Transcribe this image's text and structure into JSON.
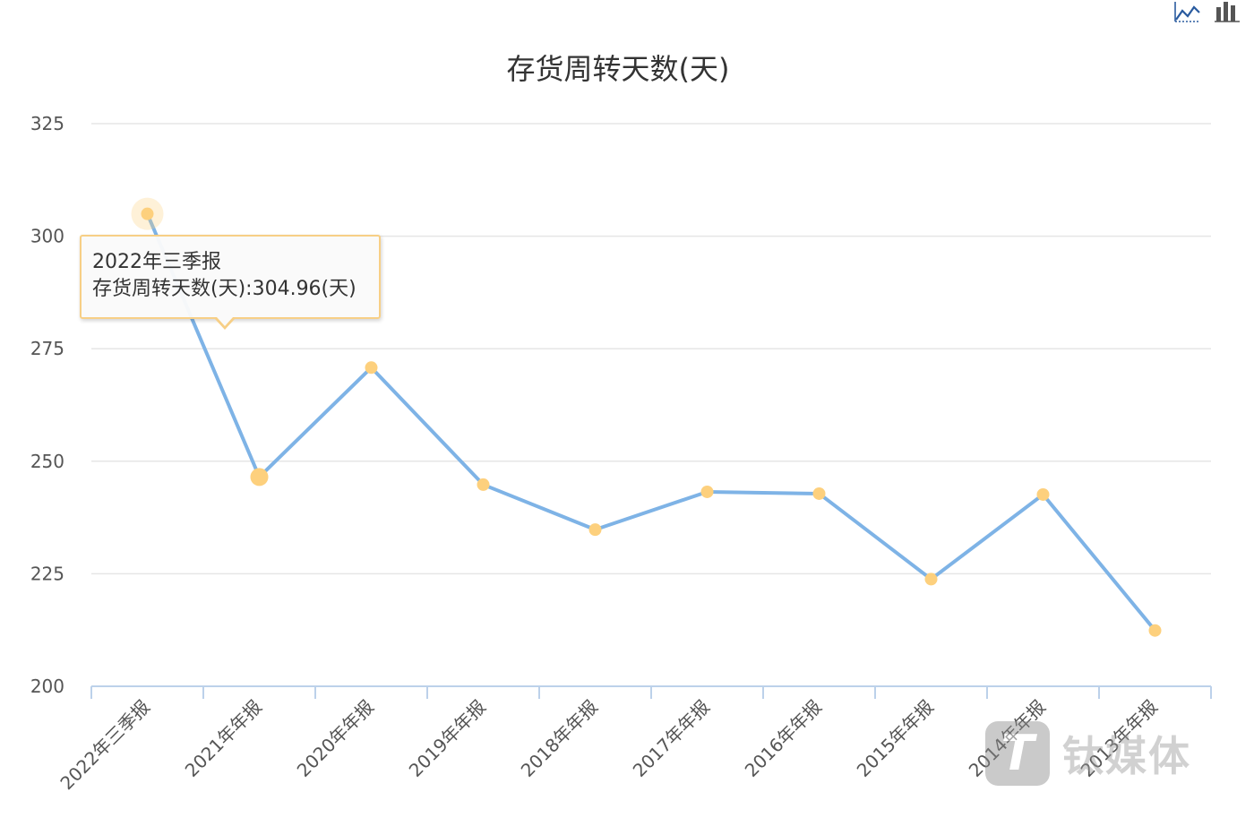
{
  "toolbar": {
    "icons": [
      {
        "name": "line-chart-icon",
        "label": "折线图"
      },
      {
        "name": "bar-chart-icon",
        "label": "柱状图"
      }
    ]
  },
  "tooltip": {
    "category": "2022年三季报",
    "text": "存货周转天数(天):304.96(天)"
  },
  "watermark": {
    "logo_text": "T",
    "text": "钛媒体"
  },
  "colors": {
    "line": "#7eb3e6",
    "marker": "#fdd07d",
    "grid": "#e6e6e6",
    "axis": "#bcd1ea"
  },
  "chart_data": {
    "type": "line",
    "title": "存货周转天数(天)",
    "xlabel": "",
    "ylabel": "",
    "categories": [
      "2022年三季报",
      "2021年年报",
      "2020年年报",
      "2019年年报",
      "2018年年报",
      "2017年年报",
      "2016年年报",
      "2015年年报",
      "2014年年报",
      "2013年年报"
    ],
    "series": [
      {
        "name": "存货周转天数(天)",
        "values": [
          304.96,
          246.5,
          270.8,
          244.8,
          234.8,
          243.2,
          242.8,
          223.8,
          242.6,
          212.4
        ]
      }
    ],
    "ylim": [
      200,
      325
    ],
    "yticks": [
      200,
      225,
      250,
      275,
      300,
      325
    ],
    "grid": true,
    "legend": "none",
    "highlighted_index": 0
  }
}
